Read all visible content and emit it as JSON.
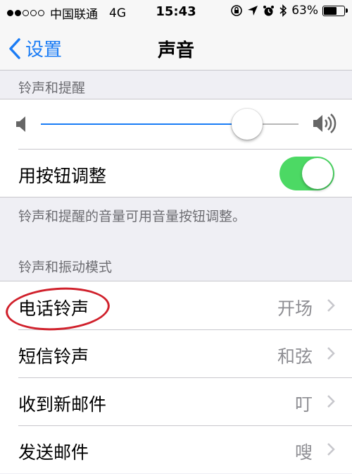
{
  "status_bar": {
    "carrier": "中国联通",
    "network": "4G",
    "time": "15:43",
    "battery": "63%",
    "battery_level": 0.63
  },
  "nav": {
    "back_label": "设置",
    "title": "声音"
  },
  "ringer_section": {
    "header": "铃声和提醒",
    "volume_level": 0.8,
    "toggle_label": "用按钮调整",
    "toggle_on": true,
    "footer": "铃声和提醒的音量可用音量按钮调整。"
  },
  "sounds_section": {
    "header": "铃声和振动模式",
    "items": [
      {
        "label": "电话铃声",
        "value": "开场"
      },
      {
        "label": "短信铃声",
        "value": "和弦"
      },
      {
        "label": "收到新邮件",
        "value": "叮"
      },
      {
        "label": "发送邮件",
        "value": "嗖"
      }
    ]
  },
  "colors": {
    "accent": "#1a7cf5",
    "toggle_on": "#4cd964",
    "annotation": "#d0202b"
  }
}
